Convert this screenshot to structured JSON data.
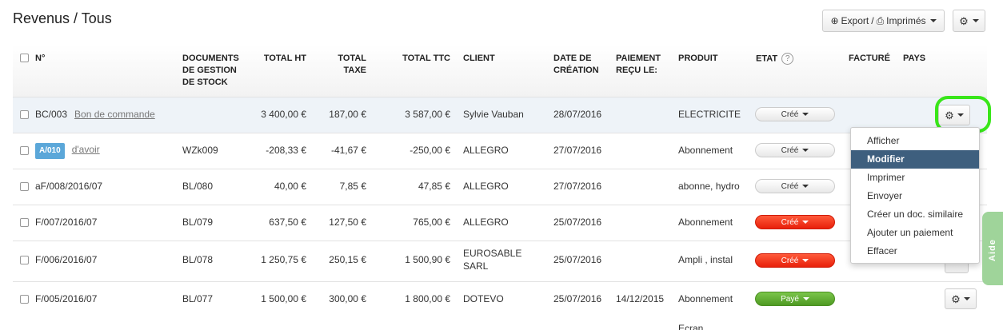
{
  "page": {
    "title": "Revenus / Tous"
  },
  "toolbar": {
    "export_label": "Export",
    "print_label": "Imprimés",
    "separator": "/"
  },
  "table": {
    "headers": {
      "num": "N°",
      "docs": [
        "DOCUMENTS",
        "DE GESTION",
        "DE STOCK"
      ],
      "total_ht": "TOTAL HT",
      "total_taxe": [
        "TOTAL",
        "TAXE"
      ],
      "total_ttc": "TOTAL TTC",
      "client": "CLIENT",
      "date": [
        "DATE DE",
        "CRÉATION"
      ],
      "paiement": [
        "PAIEMENT",
        "REÇU LE:"
      ],
      "produit": "PRODUIT",
      "etat": "ETAT",
      "etat_help": "?",
      "facture": "FACTURÉ",
      "pays": "PAYS"
    },
    "rows": [
      {
        "num": "BC/003",
        "doc_link": "Bon de commande",
        "stock": "",
        "ht": "3 400,00 €",
        "taxe": "187,00 €",
        "ttc": "3 587,00 €",
        "client": "Sylvie Vauban",
        "client2": "",
        "date": "28/07/2016",
        "paiement": "",
        "produit": "ELECTRICITE",
        "etat": "Créé",
        "etat_color": "#f5f5f5"
      },
      {
        "num_badge": "A/010",
        "doc_link": "d'avoir",
        "stock": "WZk009",
        "ht": "-208,33 €",
        "taxe": "-41,67 €",
        "ttc": "-250,00 €",
        "client": "ALLEGRO",
        "client2": "",
        "date": "27/07/2016",
        "paiement": "",
        "produit": "Abonnement",
        "etat": "Créé",
        "etat_color": "#f5f5f5"
      },
      {
        "num": "aF/008/2016/07",
        "stock": "BL/080",
        "ht": "40,00 €",
        "taxe": "7,85 €",
        "ttc": "47,85 €",
        "client": "ALLEGRO",
        "client2": "",
        "date": "27/07/2016",
        "paiement": "",
        "produit": "abonne, hydro",
        "etat": "Créé",
        "etat_color": "#f5f5f5"
      },
      {
        "num": "F/007/2016/07",
        "stock": "BL/079",
        "ht": "637,50 €",
        "taxe": "127,50 €",
        "ttc": "765,00 €",
        "client": "ALLEGRO",
        "client2": "",
        "date": "25/07/2016",
        "paiement": "",
        "produit": "Abonnement",
        "etat": "Créé",
        "etat_color": "#f0280f"
      },
      {
        "num": "F/006/2016/07",
        "stock": "BL/078",
        "ht": "1 250,75 €",
        "taxe": "250,15 €",
        "ttc": "1 500,90 €",
        "client": "EUROSABLE",
        "client2": "SARL",
        "date": "25/07/2016",
        "paiement": "",
        "produit": "Ampli , instal",
        "etat": "Créé",
        "etat_color": "#f0280f"
      },
      {
        "num": "F/005/2016/07",
        "stock": "BL/077",
        "ht": "1 500,00 €",
        "taxe": "300,00 €",
        "ttc": "1 800,00 €",
        "client": "DOTEVO",
        "client2": "",
        "date": "25/07/2016",
        "paiement": "14/12/2015",
        "produit": "Abonnement",
        "etat": "Payé",
        "etat_color": "#5ca72e"
      }
    ],
    "partial_next_produit": "Ecran"
  },
  "action_menu": {
    "items": [
      "Afficher",
      "Modifier",
      "Imprimer",
      "Envoyer",
      "Créer un doc. similaire",
      "Ajouter un paiement",
      "Effacer"
    ],
    "active": "Modifier"
  },
  "help_tab": {
    "label": "Aide"
  },
  "icons": {
    "gear": "gear-icon",
    "export": "export-icon",
    "print": "print-icon",
    "caret": "chevron-down-icon"
  },
  "colors": {
    "highlight_ring": "#39e61a",
    "menu_active": "#3e5f7e",
    "badge": "#5ba7d9",
    "help_tab": "#9fd49a"
  }
}
